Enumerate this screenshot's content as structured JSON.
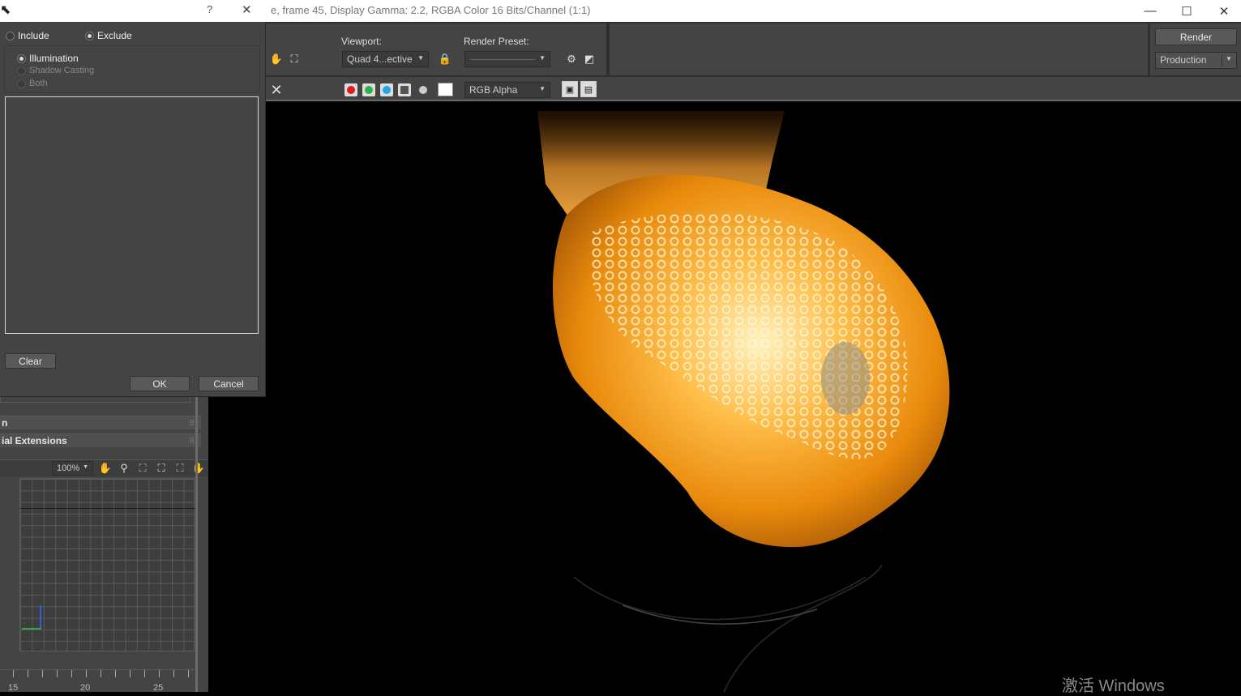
{
  "frame_window": {
    "title": "e, frame 45, Display Gamma: 2.2, RGBA Color 16 Bits/Channel (1:1)",
    "minimize_glyph": "—",
    "maximize_glyph": "☐",
    "close_glyph": "✕"
  },
  "toolbar": {
    "viewport_label": "Viewport:",
    "viewport_value": "Quad 4...ective",
    "render_preset_label": "Render Preset:",
    "render_preset_value": "",
    "render_button": "Render",
    "production_value": "Production",
    "channel_value": "RGB Alpha",
    "clear_glyph": "✕"
  },
  "dialog": {
    "help_glyph": "?",
    "close_glyph": "✕",
    "include_label": "Include",
    "exclude_label": "Exclude",
    "mode_selected": "Exclude",
    "illumination_label": "Illumination",
    "shadow_casting_label": "Shadow Casting",
    "both_label": "Both",
    "clear_button": "Clear",
    "ok_button": "OK",
    "cancel_button": "Cancel"
  },
  "left_panel": {
    "rollout_1": "n",
    "rollout_2": "ial Extensions",
    "zoom_value": "100%",
    "ruler_labels": [
      "15",
      "20",
      "25"
    ]
  },
  "watermark": "激活 Windows",
  "colors": {
    "panel_bg": "#444444",
    "fire_orange": "#f5a623",
    "red_channel": "#e01b1b",
    "green_channel": "#2fb04a",
    "blue_channel": "#1fa6e8"
  }
}
